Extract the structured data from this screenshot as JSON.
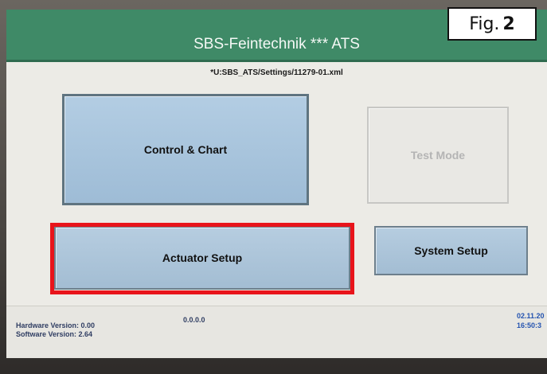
{
  "header": {
    "title": "SBS-Feintechnik *** ATS",
    "file_path": "*U:SBS_ATS/Settings/11279-01.xml"
  },
  "buttons": {
    "control_chart": "Control & Chart",
    "test_mode": "Test Mode",
    "actuator_setup": "Actuator Setup",
    "system_setup": "System Setup"
  },
  "footer": {
    "hardware_version": "Hardware Version: 0.00",
    "software_version": "Software Version: 2.64",
    "ip_address": "0.0.0.0",
    "date": "02.11.20",
    "time": "16:50:3"
  },
  "annotation": {
    "fig_prefix": "Fig.",
    "fig_number": "2"
  },
  "colors": {
    "header": "#3f8a67",
    "button_blue": "#a9c5dd",
    "button_disabled": "#e9e8e4",
    "highlight_red": "#e8141b",
    "footer_text": "#2f3d62",
    "datetime_text": "#2453b0"
  }
}
